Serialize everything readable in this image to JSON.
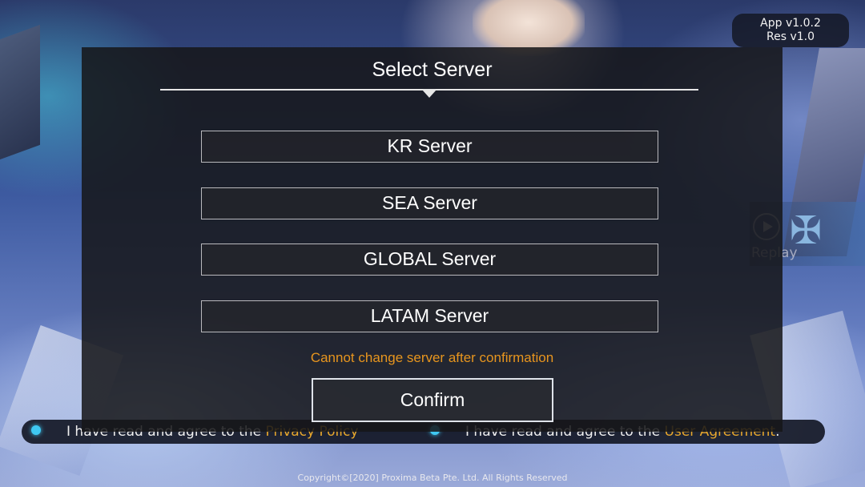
{
  "version": {
    "app": "App v1.0.2",
    "res": "Res v1.0"
  },
  "dialog": {
    "title": "Select Server",
    "servers": [
      {
        "label": "KR Server"
      },
      {
        "label": "SEA Server"
      },
      {
        "label": "GLOBAL Server"
      },
      {
        "label": "LATAM Server"
      }
    ],
    "warning": "Cannot change server after confirmation",
    "confirm_label": "Confirm"
  },
  "replay": {
    "label": "Replay"
  },
  "agreements": {
    "privacy_prefix": "I have read and agree to the ",
    "privacy_link": "Privacy Policy",
    "user_prefix": "I have read and agree to the ",
    "user_link": "User Agreement",
    "user_suffix": "."
  },
  "footer": {
    "copyright": "Copyright©[2020] Proxima Beta Pte. Ltd. All Rights Reserved"
  },
  "colors": {
    "warning": "#e8951e",
    "link": "#e9a82c",
    "agree_dot": "#3fc8f2"
  },
  "icons": {
    "replay": "play-circle-icon",
    "emblem": "game-emblem-icon"
  }
}
